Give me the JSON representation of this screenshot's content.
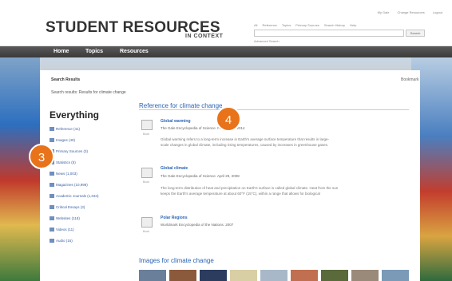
{
  "header": {
    "logo": "STUDENT RESOURCES",
    "logo_sub": "IN CONTEXT",
    "top_links": [
      "My Gale",
      "Change Resources",
      "Logout"
    ],
    "search_tabs": [
      "All",
      "Reference",
      "Topics",
      "Primary Sources",
      "Search History",
      "Help"
    ],
    "search_button": "Search",
    "advanced_search": "Advanced Search"
  },
  "nav": {
    "items": [
      "Home",
      "Topics",
      "Resources"
    ]
  },
  "panel": {
    "title": "Search Results",
    "description": "Search results: Results for climate change",
    "bookmark": "Bookmark"
  },
  "sidebar": {
    "heading": "Everything",
    "categories": [
      "Reference (41)",
      "Images (40)",
      "Primary Sources (3)",
      "Statistics (5)",
      "News (1,003)",
      "Magazines (10,998)",
      "Academic Journals (1,034)",
      "Critical Essays (3)",
      "Websites (118)",
      "Videos (11)",
      "Audio (15)"
    ]
  },
  "reference": {
    "heading": "Reference for climate change",
    "results": [
      {
        "title": "Global warming",
        "source": "The Gale Encyclopedia of Science.  February 6, 2014",
        "text_1": "Global warming refers to a long-term increase in Earth's average surface temperature that results in large-",
        "text_2": "scale changes in global climate, including rising temperatures, caused by increases in greenhouse gases.",
        "icon_label": "Book"
      },
      {
        "title": "Global climate",
        "source": "The Gale Encyclopedia of Science.  April 29, 2008",
        "text_1": "The long-term distribution of heat and precipitation on Earth's surface is called global climate. Heat from the sun",
        "text_2": "keeps the Earth's average temperature at about 60°F (15°C), within a range that allows for biological",
        "icon_label": "Book"
      },
      {
        "title": "Polar Regions",
        "source": "Worldmark Encyclopedia of the Nations.  2007",
        "text_1": "",
        "text_2": "",
        "icon_label": "Book"
      }
    ]
  },
  "images": {
    "heading": "Images for climate change",
    "thumb_colors": [
      "#6a7f9a",
      "#8b5a3c",
      "#2b3c5e",
      "#d9cfa5",
      "#a8b8c8",
      "#c07050",
      "#5a6a3a",
      "#9a8a7a",
      "#7a9ab8"
    ]
  },
  "callouts": {
    "three": "3",
    "four": "4"
  },
  "colors": {
    "accent": "#e8731a",
    "link": "#2a64b4",
    "nav_bg": "#4a4a4a"
  }
}
